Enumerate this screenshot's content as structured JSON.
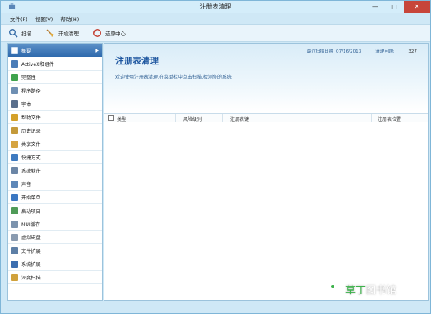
{
  "window": {
    "title": "注册表清理",
    "minimize": "—",
    "maximize": "□",
    "close": "✕"
  },
  "menu": [
    "文件(F)",
    "视图(V)",
    "帮助(H)"
  ],
  "toolbar": [
    {
      "label": "扫描",
      "icon": "magnifier-icon"
    },
    {
      "label": "开始清理",
      "icon": "broom-icon"
    },
    {
      "label": "还原中心",
      "icon": "restore-icon"
    }
  ],
  "sidebar": {
    "items": [
      {
        "label": "概要",
        "icon": "overview-icon",
        "color": "#ffffff"
      },
      {
        "label": "ActiveX和组件",
        "icon": "activex-icon",
        "color": "#4a7db8"
      },
      {
        "label": "完整性",
        "icon": "integrity-icon",
        "color": "#3fa34d"
      },
      {
        "label": "程序路径",
        "icon": "program-path-icon",
        "color": "#6e8fb3"
      },
      {
        "label": "字体",
        "icon": "font-icon",
        "color": "#5a6f8c"
      },
      {
        "label": "帮助文件",
        "icon": "help-file-icon",
        "color": "#d4a12a"
      },
      {
        "label": "历史记录",
        "icon": "history-icon",
        "color": "#c49a3a"
      },
      {
        "label": "共享文件",
        "icon": "shared-file-icon",
        "color": "#d6a440"
      },
      {
        "label": "快捷方式",
        "icon": "shortcut-icon",
        "color": "#3d7ac0"
      },
      {
        "label": "系统软件",
        "icon": "system-software-icon",
        "color": "#6b86a6"
      },
      {
        "label": "声音",
        "icon": "sound-icon",
        "color": "#5d87b8"
      },
      {
        "label": "开始菜单",
        "icon": "start-menu-icon",
        "color": "#3a77c2"
      },
      {
        "label": "启动项目",
        "icon": "startup-icon",
        "color": "#4f9b58"
      },
      {
        "label": "MUI缓存",
        "icon": "mui-cache-icon",
        "color": "#7c93ad"
      },
      {
        "label": "虚拟磁盘",
        "icon": "virtual-disk-icon",
        "color": "#8a9bb0"
      },
      {
        "label": "文件扩展",
        "icon": "file-extension-icon",
        "color": "#5d7fa6"
      },
      {
        "label": "系统扩展",
        "icon": "system-extension-icon",
        "color": "#3c6fb0"
      },
      {
        "label": "深度扫描",
        "icon": "deep-scan-icon",
        "color": "#d0a23c"
      }
    ]
  },
  "main": {
    "title": "注册表清理",
    "description": "欢迎使用注册表清理,在菜单栏中点击扫描,检测你的系统",
    "last_scan_label": "最近扫描日期: 07/16/2013",
    "issues_label": "清理问题:",
    "issues_value": "327",
    "columns": [
      "类型",
      "风险级别",
      "注册表键",
      "注册表位置"
    ]
  },
  "watermark": {
    "prefix": "草丁",
    "suffix": "图书馆"
  }
}
